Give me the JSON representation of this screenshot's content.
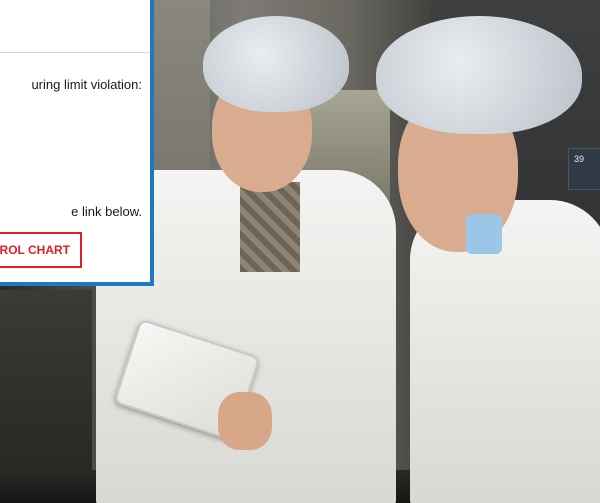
{
  "email": {
    "line_violation": "uring limit violation:",
    "line_link": "e link below.",
    "button_label": "ROL CHART"
  },
  "device": {
    "readout": "39"
  },
  "colors": {
    "card_border": "#1e78c2",
    "button_accent": "#e01f26"
  }
}
